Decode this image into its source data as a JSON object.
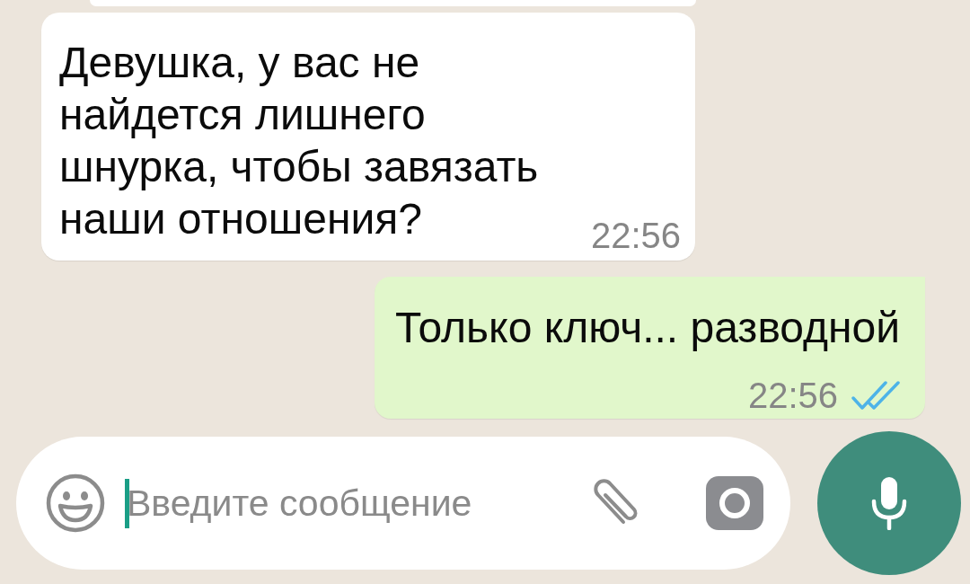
{
  "messages": [
    {
      "kind": "incoming",
      "text": "Девушка, у вас не найдется лишнего шнурка, чтобы завязать наши отношения?",
      "time": "22:56"
    },
    {
      "kind": "outgoing",
      "text": "Только ключ... разводной",
      "time": "22:56",
      "read": true
    }
  ],
  "composer": {
    "placeholder": "Введите сообщение",
    "focused": true
  }
}
